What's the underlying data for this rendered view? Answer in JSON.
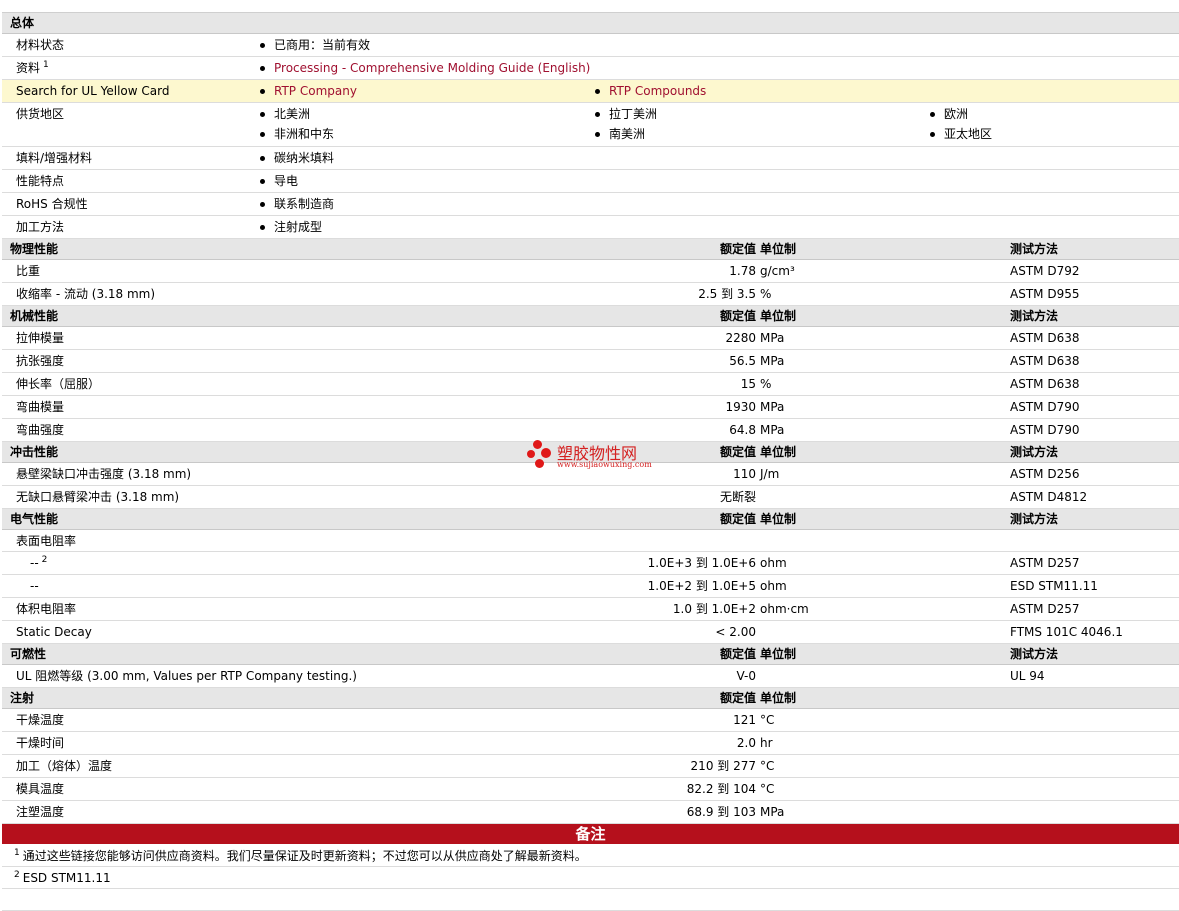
{
  "general": {
    "title": "总体",
    "status_label": "材料状态",
    "status_value": "已商用：当前有效",
    "docs_label": "资料",
    "docs_sup": "1",
    "docs_link": "Processing - Comprehensive Molding Guide (English)",
    "ul_label": "Search for UL Yellow Card",
    "ul_link_1": "RTP Company",
    "ul_link_2": "RTP Compounds",
    "regions_label": "供货地区",
    "regions": [
      "北美洲",
      "拉丁美洲",
      "欧洲",
      "非洲和中东",
      "南美洲",
      "亚太地区"
    ],
    "filler_label": "填料/增强材料",
    "filler_value": "碳纳米填料",
    "features_label": "性能特点",
    "features_value": "导电",
    "rohs_label": "RoHS 合规性",
    "rohs_value": "联系制造商",
    "process_label": "加工方法",
    "process_value": "注射成型"
  },
  "headers": {
    "value": "额定值",
    "unit": "单位制",
    "test": "测试方法"
  },
  "physical": {
    "title": "物理性能",
    "rows": [
      {
        "label": "比重",
        "value": "1.78",
        "unit": "g/cm³",
        "test": "ASTM D792"
      },
      {
        "label": "收缩率  - 流动  (3.18 mm)",
        "value": "2.5 到  3.5",
        "unit": "%",
        "test": "ASTM D955"
      }
    ]
  },
  "mechanical": {
    "title": "机械性能",
    "rows": [
      {
        "label": "拉伸模量",
        "value": "2280",
        "unit": "MPa",
        "test": "ASTM D638"
      },
      {
        "label": "抗张强度",
        "value": "56.5",
        "unit": "MPa",
        "test": "ASTM D638"
      },
      {
        "label": "伸长率（屈服）",
        "value": "15",
        "unit": "%",
        "test": "ASTM D638"
      },
      {
        "label": "弯曲模量",
        "value": "1930",
        "unit": "MPa",
        "test": "ASTM D790"
      },
      {
        "label": "弯曲强度",
        "value": "64.8",
        "unit": "MPa",
        "test": "ASTM D790"
      }
    ]
  },
  "impact": {
    "title": "冲击性能",
    "rows": [
      {
        "label": "悬壁梁缺口冲击强度  (3.18 mm)",
        "value": "110",
        "unit": "J/m",
        "test": "ASTM D256"
      },
      {
        "label": "无缺口悬臂梁冲击  (3.18 mm)",
        "value": "无断裂",
        "unit": "",
        "test": "ASTM D4812"
      }
    ]
  },
  "electrical": {
    "title": "电气性能",
    "surface_label": "表面电阻率",
    "rows": [
      {
        "label": "--",
        "sup": "2",
        "value": "1.0E+3 到  1.0E+6",
        "unit": "ohm",
        "test": "ASTM D257"
      },
      {
        "label": "--",
        "sup": "",
        "value": "1.0E+2 到  1.0E+5",
        "unit": "ohm",
        "test": "ESD STM11.11"
      },
      {
        "label": "体积电阻率",
        "sup": "",
        "value": "1.0 到  1.0E+2",
        "unit": "ohm·cm",
        "test": "ASTM D257"
      },
      {
        "label": "Static Decay",
        "sup": "",
        "value": "< 2.00",
        "unit": "",
        "test": "FTMS 101C 4046.1"
      }
    ]
  },
  "flammability": {
    "title": "可燃性",
    "rows": [
      {
        "label": "UL 阻燃等级  (3.00 mm, Values per RTP Company testing.)",
        "value": "V-0",
        "unit": "",
        "test": "UL 94"
      }
    ]
  },
  "injection": {
    "title": "注射",
    "rows": [
      {
        "label": "干燥温度",
        "value": "121",
        "unit": "°C"
      },
      {
        "label": "干燥时间",
        "value": "2.0",
        "unit": "hr"
      },
      {
        "label": "加工（熔体）温度",
        "value": "210 到  277",
        "unit": "°C"
      },
      {
        "label": "模具温度",
        "value": "82.2 到  104",
        "unit": "°C"
      },
      {
        "label": "注塑温度",
        "value": "68.9 到  103",
        "unit": "MPa"
      }
    ]
  },
  "notes": {
    "title": "备注",
    "items": [
      {
        "sup": "1",
        "text": "通过这些链接您能够访问供应商资料。我们尽量保证及时更新资料；不过您可以从供应商处了解最新资料。"
      },
      {
        "sup": "2",
        "text": "ESD STM11.11"
      }
    ]
  },
  "watermark": {
    "name": "塑胶物性网",
    "url": "www.sujiaowuxing.com"
  },
  "colors": {
    "section_bg": "#e6e6e6",
    "highlight_bg": "#fdf8cf",
    "link": "#a01030",
    "notes_bar": "#b5101c"
  }
}
